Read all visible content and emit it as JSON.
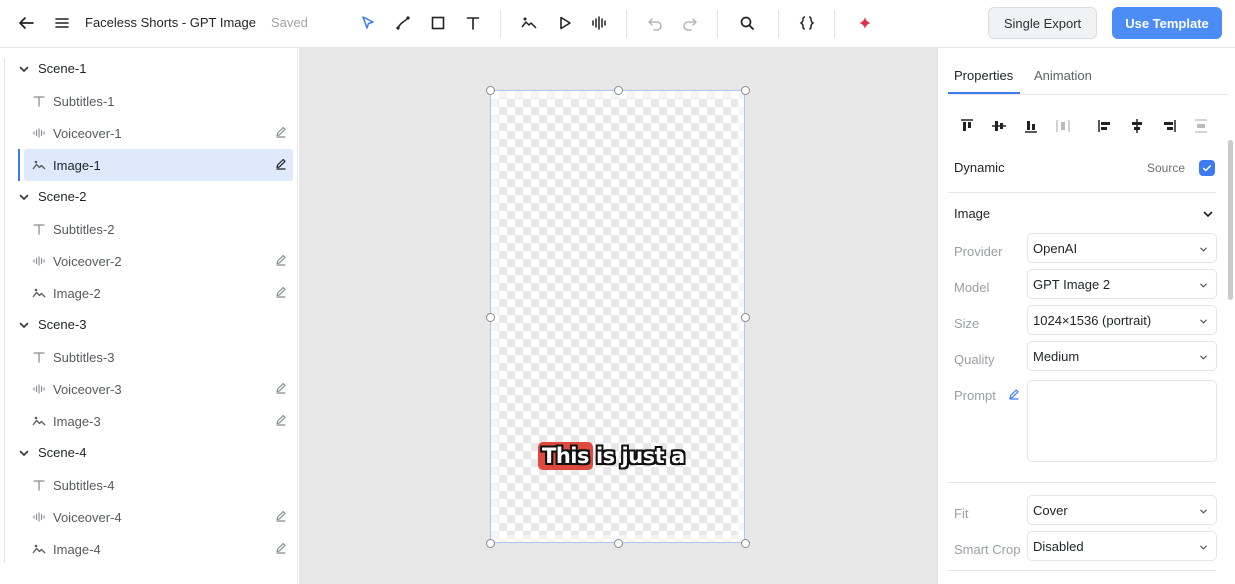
{
  "header": {
    "title": "Faceless Shorts - GPT Image",
    "status": "Saved",
    "single_export_label": "Single Export",
    "use_template_label": "Use Template",
    "tools": [
      "back-arrow-icon",
      "menu-icon",
      "select-cursor-icon",
      "line-tool-icon",
      "rectangle-tool-icon",
      "text-tool-icon",
      "image-tool-icon",
      "play-icon",
      "audio-wave-icon",
      "undo-icon",
      "redo-icon",
      "search-icon",
      "code-braces-icon",
      "sparkle-icon"
    ],
    "accent_color": "#4b8cf5"
  },
  "tree": {
    "scenes": [
      {
        "label": "Scene-1",
        "children": [
          {
            "type": "text",
            "label": "Subtitles-1",
            "editable": false
          },
          {
            "type": "audio",
            "label": "Voiceover-1",
            "editable": true
          },
          {
            "type": "image",
            "label": "Image-1",
            "editable": true,
            "selected": true
          }
        ]
      },
      {
        "label": "Scene-2",
        "children": [
          {
            "type": "text",
            "label": "Subtitles-2",
            "editable": false
          },
          {
            "type": "audio",
            "label": "Voiceover-2",
            "editable": true
          },
          {
            "type": "image",
            "label": "Image-2",
            "editable": true
          }
        ]
      },
      {
        "label": "Scene-3",
        "children": [
          {
            "type": "text",
            "label": "Subtitles-3",
            "editable": false
          },
          {
            "type": "audio",
            "label": "Voiceover-3",
            "editable": true
          },
          {
            "type": "image",
            "label": "Image-3",
            "editable": true
          }
        ]
      },
      {
        "label": "Scene-4",
        "children": [
          {
            "type": "text",
            "label": "Subtitles-4",
            "editable": false
          },
          {
            "type": "audio",
            "label": "Voiceover-4",
            "editable": true
          },
          {
            "type": "image",
            "label": "Image-4",
            "editable": true
          }
        ]
      }
    ]
  },
  "canvas": {
    "caption_highlight": "This",
    "caption_rest": "is just a",
    "highlight_color": "#e0493e"
  },
  "panel": {
    "tabs": [
      {
        "label": "Properties",
        "active": true
      },
      {
        "label": "Animation",
        "active": false
      }
    ],
    "dynamic_label": "Dynamic",
    "source_label": "Source",
    "source_checked": true,
    "image_section": "Image",
    "fields": {
      "provider": {
        "label": "Provider",
        "value": "OpenAI"
      },
      "model": {
        "label": "Model",
        "value": "GPT Image 2"
      },
      "size": {
        "label": "Size",
        "value": "1024×1536 (portrait)"
      },
      "quality": {
        "label": "Quality",
        "value": "Medium"
      },
      "prompt": {
        "label": "Prompt",
        "value": ""
      },
      "fit": {
        "label": "Fit",
        "value": "Cover"
      },
      "smart_crop": {
        "label": "Smart Crop",
        "value": "Disabled"
      }
    }
  }
}
